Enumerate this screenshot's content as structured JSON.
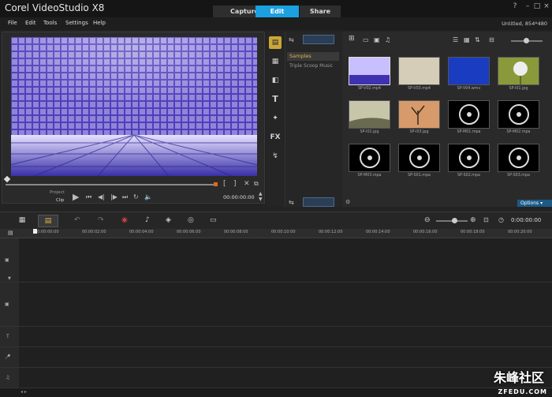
{
  "app": {
    "title": "Corel VideoStudio X8"
  },
  "tabs": [
    {
      "label": "Capture"
    },
    {
      "label": "Edit"
    },
    {
      "label": "Share"
    }
  ],
  "menu": [
    {
      "label": "File"
    },
    {
      "label": "Edit"
    },
    {
      "label": "Tools"
    },
    {
      "label": "Settings"
    },
    {
      "label": "Help"
    }
  ],
  "project_info": "Untitled, 854*480",
  "player": {
    "project_label": "Project",
    "clip_label": "Clip",
    "timecode": "00:00:00:00"
  },
  "library": {
    "folders": [
      {
        "label": "Samples"
      },
      {
        "label": "Triple Scoop Music"
      }
    ],
    "options_label": "Options",
    "items": [
      {
        "name": "SP-V02.mp4",
        "kind": "video"
      },
      {
        "name": "SP-V03.mp4",
        "kind": "video"
      },
      {
        "name": "SP-V04.wmv",
        "kind": "video"
      },
      {
        "name": "SP-I01.jpg",
        "kind": "image"
      },
      {
        "name": "SP-I02.jpg",
        "kind": "image"
      },
      {
        "name": "SP-I03.jpg",
        "kind": "image"
      },
      {
        "name": "SP-M01.mpa",
        "kind": "audio"
      },
      {
        "name": "SP-M02.mpa",
        "kind": "audio"
      },
      {
        "name": "SP-M03.mpa",
        "kind": "audio"
      },
      {
        "name": "SP-S01.mpa",
        "kind": "audio"
      },
      {
        "name": "SP-S02.mpa",
        "kind": "audio"
      },
      {
        "name": "SP-S03.mpa",
        "kind": "audio"
      }
    ]
  },
  "timeline": {
    "timecode": "0:00:00:00",
    "ruler": [
      "00:00:00:00",
      "00:00:02:00",
      "00:00:04:00",
      "00:00:06:00",
      "00:00:08:00",
      "00:00:10:00",
      "00:00:12:00",
      "00:00:14:00",
      "00:00:16:00",
      "00:00:18:00",
      "00:00:20:00"
    ]
  },
  "watermark": {
    "text": "朱峰社区",
    "url": "ZFEDU.COM"
  }
}
